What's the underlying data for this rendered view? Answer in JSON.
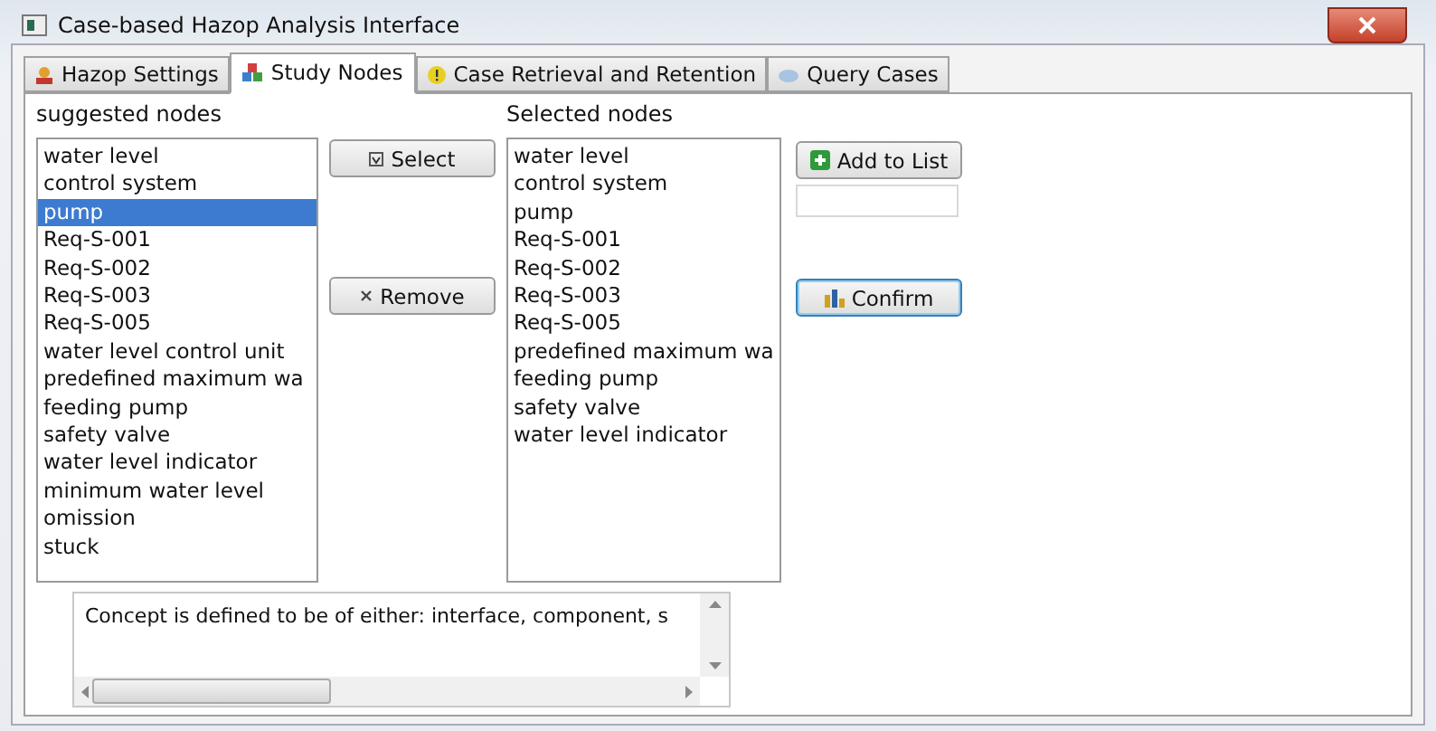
{
  "window": {
    "title": "Case-based Hazop Analysis Interface"
  },
  "tabs": [
    {
      "label": "Hazop Settings",
      "selected": false
    },
    {
      "label": "Study Nodes",
      "selected": true
    },
    {
      "label": "Case Retrieval and Retention",
      "selected": false
    },
    {
      "label": "Query Cases",
      "selected": false
    }
  ],
  "suggested_nodes": {
    "label": "suggested nodes",
    "items": [
      {
        "text": "water level",
        "selected": false
      },
      {
        "text": "control system",
        "selected": false
      },
      {
        "text": "pump",
        "selected": true
      },
      {
        "text": "Req-S-001",
        "selected": false
      },
      {
        "text": "Req-S-002",
        "selected": false
      },
      {
        "text": "Req-S-003",
        "selected": false
      },
      {
        "text": "Req-S-005",
        "selected": false
      },
      {
        "text": "water level control unit",
        "selected": false
      },
      {
        "text": "predefined maximum wa",
        "selected": false
      },
      {
        "text": "feeding pump",
        "selected": false
      },
      {
        "text": "safety valve",
        "selected": false
      },
      {
        "text": "water level indicator",
        "selected": false
      },
      {
        "text": "minimum water level",
        "selected": false
      },
      {
        "text": "omission",
        "selected": false
      },
      {
        "text": "stuck",
        "selected": false
      }
    ]
  },
  "middle_buttons": [
    "Select",
    "Remove"
  ],
  "selected_nodes": {
    "label": "Selected nodes",
    "items": [
      {
        "text": "water level",
        "selected": false
      },
      {
        "text": "control system",
        "selected": false
      },
      {
        "text": "pump",
        "selected": false
      },
      {
        "text": "Req-S-001",
        "selected": false
      },
      {
        "text": "Req-S-002",
        "selected": false
      },
      {
        "text": "Req-S-003",
        "selected": false
      },
      {
        "text": "Req-S-005",
        "selected": false
      },
      {
        "text": "predefined maximum wa",
        "selected": false
      },
      {
        "text": "feeding pump",
        "selected": false
      },
      {
        "text": "safety valve",
        "selected": false
      },
      {
        "text": "water level indicator",
        "selected": false
      }
    ]
  },
  "right_buttons": {
    "add": "Add to List",
    "confirm": "Confirm"
  },
  "description": "Concept is defined to be of either: interface, component, s"
}
